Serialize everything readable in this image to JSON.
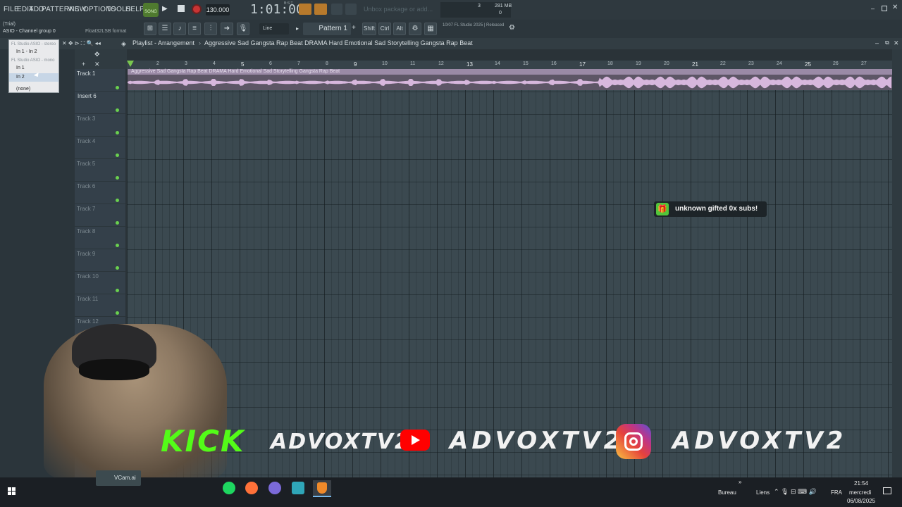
{
  "app": {
    "mode_text": "(Trial)",
    "asio_label": "ASIO - Channel group 0",
    "format_label": "Float32LSB format",
    "tempo": "130.000",
    "time_display": "1:01:00",
    "time_sub": "B:S:T",
    "pattern": "Pattern 1",
    "snap": "Line",
    "memory": "281 MB",
    "cpu_val": "3",
    "poly_val": "0",
    "hint_text": "10/07  FL Studio 2025 | Released",
    "hint_ghost": "Unbox package or add..."
  },
  "menu": [
    "FILE",
    "EDIT",
    "ADD",
    "PATTERNS",
    "VIEW",
    "OPTIONS",
    "TOOLS",
    "HELP"
  ],
  "modifier_keys": [
    "Shift",
    "Ctrl",
    "Alt"
  ],
  "playlist": {
    "breadcrumb": "Playlist - Arrangement",
    "separator": "›",
    "title": "Aggressive Sad Gangsta Rap Beat DRAMA Hard Emotional Sad Storytelling Gangsta Rap Beat",
    "clip_title": "Aggressive Sad Gangsta Rap Beat DRAMA Hard Emotional Sad Storytelling Gangsta Rap Beat"
  },
  "ruler": [
    "2",
    "3",
    "4",
    "5",
    "6",
    "7",
    "8",
    "9",
    "10",
    "11",
    "12",
    "13",
    "14",
    "15",
    "16",
    "17",
    "18",
    "19",
    "20",
    "21",
    "22",
    "23",
    "24",
    "25",
    "26",
    "27"
  ],
  "tracks": [
    {
      "name": "Track 1"
    },
    {
      "name": "Insert 6"
    },
    {
      "name": "Track 3"
    },
    {
      "name": "Track 4"
    },
    {
      "name": "Track 5"
    },
    {
      "name": "Track 6"
    },
    {
      "name": "Track 7"
    },
    {
      "name": "Track 8"
    },
    {
      "name": "Track 9"
    },
    {
      "name": "Track 10"
    },
    {
      "name": "Track 11"
    },
    {
      "name": "Track 12"
    }
  ],
  "dropdown": {
    "header1": "FL Studio ASIO - stereo",
    "item1": "In 1 - In 2",
    "header2": "FL Studio ASIO - mono",
    "item2": "In 1",
    "item3": "In 2",
    "item4": "(none)"
  },
  "notification": "unknown gifted 0x subs!",
  "overlay": {
    "kick": "KICK",
    "name1": "ADVOXTV2",
    "name2": "ADVOXTV2",
    "name3": "ADVOXTV2",
    "vcam": "VCam.ai"
  },
  "taskbar": {
    "desktop": "Bureau",
    "links": "Liens",
    "lang": "FRA",
    "time": "21:54",
    "day": "mercredi",
    "date": "06/08/2025"
  },
  "colors": {
    "accent_green": "#6ad14e",
    "kick_green": "#53fc18",
    "youtube_red": "#ff0000",
    "clip_purple": "#9a8aa6"
  }
}
